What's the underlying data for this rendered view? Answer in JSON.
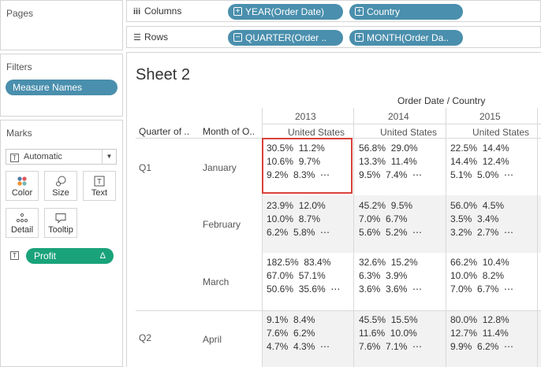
{
  "panes": {
    "pages_title": "Pages",
    "filters_title": "Filters",
    "filter_pill": "Measure Names",
    "marks_title": "Marks",
    "mark_type": "Automatic",
    "buttons": [
      {
        "label": "Color",
        "icon": "color-icon"
      },
      {
        "label": "Size",
        "icon": "size-icon"
      },
      {
        "label": "Text",
        "icon": "text-icon"
      },
      {
        "label": "Detail",
        "icon": "detail-icon"
      },
      {
        "label": "Tooltip",
        "icon": "tooltip-icon"
      }
    ],
    "profit_pill": "Profit",
    "profit_delta": "Δ"
  },
  "shelves": {
    "columns_label": "Columns",
    "rows_label": "Rows",
    "columns": [
      "YEAR(Order Date)",
      "Country"
    ],
    "rows": [
      "QUARTER(Order ..",
      "MONTH(Order Da.."
    ]
  },
  "view": {
    "sheet_title": "Sheet 2",
    "col_group_header": "Order Date / Country",
    "row_header_1": "Quarter of ..",
    "row_header_2": "Month of O..",
    "years": [
      "2013",
      "2014",
      "2015"
    ],
    "country": "United States",
    "quarters": [
      "Q1",
      "Q2"
    ],
    "months": [
      "January",
      "February",
      "March",
      "April"
    ],
    "cells": [
      [
        "30.5%  11.2%\n10.6%  9.7%\n9.2%  8.3%  ⋯",
        "56.8%  29.0%\n13.3%  11.4%\n9.5%  7.4%  ⋯",
        "22.5%  14.4%\n14.4%  12.4%\n5.1%  5.0%  ⋯"
      ],
      [
        "23.9%  12.0%\n10.0%  8.7%\n6.2%  5.8%  ⋯",
        "45.2%  9.5%\n7.0%  6.7%\n5.6%  5.2%  ⋯",
        "56.0%  4.5%\n3.5%  3.4%\n3.2%  2.7%  ⋯"
      ],
      [
        "182.5%  83.4%\n67.0%  57.1%\n50.6%  35.6%  ⋯",
        "32.6%  15.2%\n6.3%  3.9%\n3.6%  3.6%  ⋯",
        "66.2%  10.4%\n10.0%  8.2%\n7.0%  6.7%  ⋯"
      ],
      [
        "9.1%  8.4%\n7.6%  6.2%\n4.7%  4.3%  ⋯",
        "45.5%  15.5%\n11.6%  10.0%\n7.6%  7.1%  ⋯",
        "80.0%  12.8%\n12.7%  11.4%\n9.9%  6.2%  ⋯"
      ]
    ]
  },
  "colors": {
    "pill_blue": "#4a8fad",
    "pill_green": "#1aa37a",
    "selection": "#d9423b",
    "band": "#f2f2f2"
  }
}
